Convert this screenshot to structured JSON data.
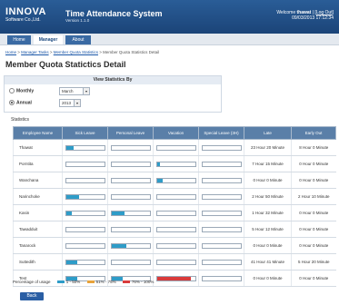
{
  "header": {
    "logo_line1": "INNOVA",
    "logo_line2": "Software Co.,Ltd.",
    "title": "Time Attendance System",
    "version": "Version 1.1.0",
    "welcome_prefix": "Welcome",
    "user": "thawat",
    "logout": "Log Out",
    "datetime": "09/03/2013 17:12:34"
  },
  "nav": {
    "tabs": [
      {
        "label": "Home"
      },
      {
        "label": "Manager"
      },
      {
        "label": "About"
      }
    ],
    "active": "Manager"
  },
  "breadcrumb": {
    "home": "Home",
    "sep1": " > ",
    "tasks": "Manager Tasks",
    "sep2": " > ",
    "stats": "Member Quota Statistics",
    "current": " > Member Quota Statistics Detail"
  },
  "page_title": "Member Quota Statictics Detail",
  "view": {
    "title": "View Statistics By",
    "monthly_label": "Monthly",
    "monthly_value": "March",
    "annual_label": "Annual",
    "annual_value": "2013",
    "selected": "Annual"
  },
  "statistics_label": "Statistics",
  "columns": [
    "Employee Name",
    "Sick Leave",
    "Personal Leave",
    "Vacation",
    "Special Leave (3H)",
    "Late",
    "Early Out"
  ],
  "rows": [
    {
      "name": "Thawat",
      "sick": 0.2,
      "personal": 0,
      "vacation": 0,
      "special": 0,
      "late": "23 Hour 20 Minute",
      "early": "8 Hour 0 Minute"
    },
    {
      "name": "Porntita",
      "sick": 0,
      "personal": 0,
      "vacation": 0.08,
      "special": 0,
      "late": "7 Hour 15 Minute",
      "early": "0 Hour 0 Minute"
    },
    {
      "name": "Wanchana",
      "sick": 0,
      "personal": 0,
      "vacation": 0.15,
      "special": 0,
      "late": "0 Hour 0 Minute",
      "early": "0 Hour 0 Minute"
    },
    {
      "name": "Narinchoke",
      "sick": 0.35,
      "personal": 0,
      "vacation": 0,
      "special": 0,
      "late": "2 Hour 50 Minute",
      "early": "2 Hour 10 Minute"
    },
    {
      "name": "Kasin",
      "sick": 0.15,
      "personal": 0.35,
      "vacation": 0,
      "special": 0,
      "late": "1 Hour 32 Minute",
      "early": "0 Hour 0 Minute"
    },
    {
      "name": "Tawadduit",
      "sick": 0,
      "personal": 0,
      "vacation": 0,
      "special": 0,
      "late": "5 Hour 12 Minute",
      "early": "0 Hour 0 Minute"
    },
    {
      "name": "Tanarock",
      "sick": 0,
      "personal": 0.4,
      "vacation": 0,
      "special": 0,
      "late": "0 Hour 0 Minute",
      "early": "0 Hour 0 Minute"
    },
    {
      "name": "Suttedith",
      "sick": 0.3,
      "personal": 0,
      "vacation": 0,
      "special": 0,
      "late": "41 Hour 41 Minute",
      "early": "5 Hour 20 Minute"
    },
    {
      "name": "Test",
      "sick": 0.3,
      "personal": 0.3,
      "vacation": 0.9,
      "special": 0,
      "late": "0 Hour 0 Minute",
      "early": "0 Hour 0 Minute"
    }
  ],
  "legend": {
    "label": "Percentage of usage",
    "items": [
      {
        "label": "1 - 50%",
        "color": "#2e9cc8"
      },
      {
        "label": "51% - 75%",
        "color": "#e7a33a"
      },
      {
        "label": "76% - 100%",
        "color": "#d93b3b"
      }
    ]
  },
  "back_label": "Back"
}
